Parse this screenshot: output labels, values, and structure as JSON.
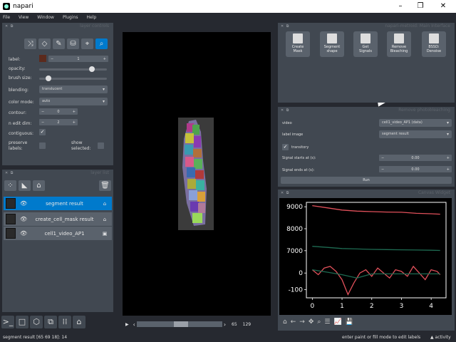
{
  "window": {
    "title": "napari",
    "min": "–",
    "max": "❐",
    "close": "✕"
  },
  "menu": [
    "File",
    "View",
    "Window",
    "Plugins",
    "Help"
  ],
  "layer_controls": {
    "header": "layer controls",
    "label_text": "label:",
    "label_value": "1",
    "opacity_text": "opacity:",
    "opacity_value": 0.8,
    "brush_text": "brush size:",
    "brush_value": 0.1,
    "blending_text": "blending:",
    "blending_value": "translucent",
    "color_mode_text": "color mode:",
    "color_mode_value": "auto",
    "contour_text": "contour:",
    "contour_value": "0",
    "n_edit_dim_text": "n edit dim:",
    "n_edit_dim_value": "2",
    "contiguous_text": "contiguous:",
    "preserve_text": "preserve\nlabels:",
    "show_selected_text": "show\nselected:"
  },
  "layer_list": {
    "header": "layer list",
    "layers": [
      {
        "name": "segment result",
        "selected": true
      },
      {
        "name": "create_cell_mask result",
        "selected": false
      },
      {
        "name": "cell1_video_AP1",
        "selected": false
      }
    ]
  },
  "slice": {
    "current": "65",
    "total": "129",
    "play": "▶",
    "left": "‹",
    "right": "›"
  },
  "status": {
    "left": "segment result [65 69 18]: 14",
    "right": "enter paint or fill mode to edit labels",
    "activity": "▲ activity"
  },
  "main_interface": {
    "header": "napari-metroid: Main Interface",
    "buttons": [
      "Create\nMask",
      "Segment\nshape",
      "Get\nSignals",
      "Remove\nBleaching",
      "BSSD:\nDenoise"
    ]
  },
  "photobleaching": {
    "header": "Remove photobleaching",
    "video_label": "video",
    "video_value": "cell1_video_AP1 (data)",
    "label_image_label": "label image",
    "label_image_value": "segment result",
    "transitory_label": "transitory",
    "signal_start_label": "Signal starts at (s):",
    "signal_start_value": "0.00",
    "signal_end_label": "Signal ends at (s):",
    "signal_end_value": "0.00",
    "run_label": "Run"
  },
  "canvas_widget": {
    "header": "Canvas Widget"
  },
  "chart_data": [
    {
      "type": "line",
      "title": "",
      "xlabel": "",
      "ylabel": "",
      "ylim": [
        6800,
        9200
      ],
      "y_ticks": [
        "9000",
        "8000",
        "7000"
      ],
      "series": [
        {
          "color": "#e0505a",
          "x": [
            0,
            0.5,
            1,
            1.5,
            2,
            2.5,
            3,
            3.5,
            4,
            4.3
          ],
          "values": [
            9050,
            8950,
            8850,
            8800,
            8780,
            8760,
            8750,
            8700,
            8680,
            8660
          ]
        },
        {
          "color": "#1e6b52",
          "x": [
            0,
            0.5,
            1,
            1.5,
            2,
            2.5,
            3,
            3.5,
            4,
            4.3
          ],
          "values": [
            7200,
            7150,
            7100,
            7080,
            7060,
            7050,
            7040,
            7030,
            7020,
            7010
          ]
        }
      ]
    },
    {
      "type": "line",
      "title": "",
      "xlabel": "",
      "ylabel": "",
      "xlim": [
        -0.2,
        4.5
      ],
      "ylim": [
        -150,
        100
      ],
      "x_ticks": [
        "0",
        "1",
        "2",
        "3",
        "4"
      ],
      "y_ticks": [
        "0",
        "-100"
      ],
      "series": [
        {
          "color": "#e0505a",
          "x": [
            0,
            0.2,
            0.4,
            0.6,
            0.8,
            1.0,
            1.2,
            1.4,
            1.6,
            1.8,
            2.0,
            2.2,
            2.4,
            2.6,
            2.8,
            3.0,
            3.2,
            3.4,
            3.6,
            3.8,
            4.0,
            4.2,
            4.3
          ],
          "values": [
            20,
            -10,
            30,
            40,
            10,
            -40,
            -130,
            -60,
            0,
            20,
            -20,
            30,
            0,
            -30,
            20,
            10,
            -20,
            40,
            0,
            -40,
            20,
            10,
            -10
          ]
        },
        {
          "color": "#1e6b52",
          "x": [
            0,
            0.5,
            1.0,
            1.5,
            2,
            3,
            4,
            4.3
          ],
          "values": [
            20,
            5,
            -10,
            -30,
            -5,
            -5,
            -5,
            -5
          ]
        }
      ]
    }
  ]
}
